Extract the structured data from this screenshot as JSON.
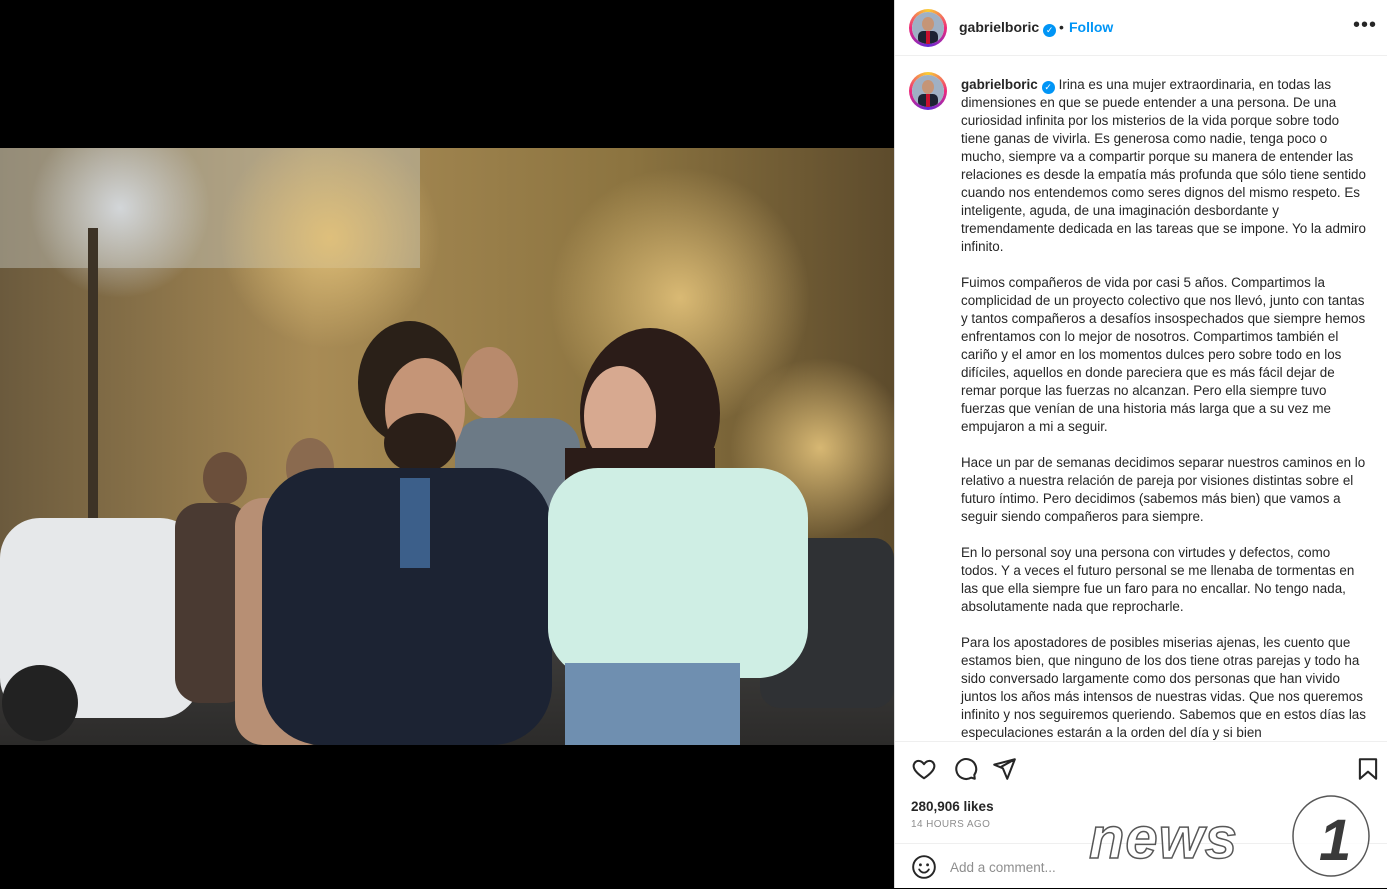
{
  "post": {
    "username": "gabrielboric",
    "verified": true,
    "dot": "•",
    "follow_label": "Follow",
    "more_icon": "more-options-icon",
    "caption_paragraphs": [
      "Irina es una mujer extraordinaria, en todas las dimensiones en que se puede entender a una persona. De una curiosidad infinita por los misterios de la vida porque sobre todo tiene ganas de vivirla. Es generosa como nadie, tenga poco o mucho, siempre va a compartir porque su manera de entender las relaciones es desde la empatía más profunda que sólo tiene sentido cuando nos entendemos como seres dignos del mismo respeto. Es inteligente, aguda, de una imaginación desbordante y tremendamente dedicada en las tareas que se impone. Yo la admiro infinito.",
      "Fuimos compañeros de vida por casi 5 años. Compartimos la complicidad de un proyecto colectivo que nos llevó, junto con tantas y tantos compañeros a desafíos insospechados que siempre hemos enfrentamos con lo mejor de nosotros. Compartimos también el cariño y el amor en los momentos dulces pero sobre todo en los difíciles, aquellos en donde pareciera que es más fácil dejar de remar porque las fuerzas no alcanzan. Pero ella siempre tuvo fuerzas que venían de una historia más larga que a su vez me empujaron a mi a seguir.",
      "Hace un par de semanas decidimos separar nuestros caminos en lo relativo a nuestra relación de pareja por visiones distintas sobre el futuro íntimo. Pero decidimos (sabemos más bien) que vamos a seguir siendo compañeros para siempre.",
      "En lo personal soy una persona con virtudes y defectos, como todos. Y a veces el futuro personal se me llenaba de tormentas en las que ella siempre fue un faro para no encallar. No tengo nada, absolutamente nada que reprocharle.",
      "Para los apostadores de posibles miserias ajenas, les cuento que estamos bien, que ninguno de los dos tiene otras parejas y todo ha sido conversado largamente como dos personas que han vivido juntos los años más intensos de nuestras vidas. Que nos queremos infinito y nos seguiremos queriendo. Sabemos que en estos días las especulaciones estarán a la orden del día y si bien"
    ],
    "likes": "280,906 likes",
    "time_ago": "14 HOURS AGO",
    "comment_placeholder": "Add a comment...",
    "icons": [
      "heart-icon",
      "comment-icon",
      "share-icon",
      "bookmark-icon",
      "emoji-icon"
    ]
  },
  "colors": {
    "link_blue": "#0095f6",
    "text": "#262626",
    "muted": "#8e8e8e"
  }
}
